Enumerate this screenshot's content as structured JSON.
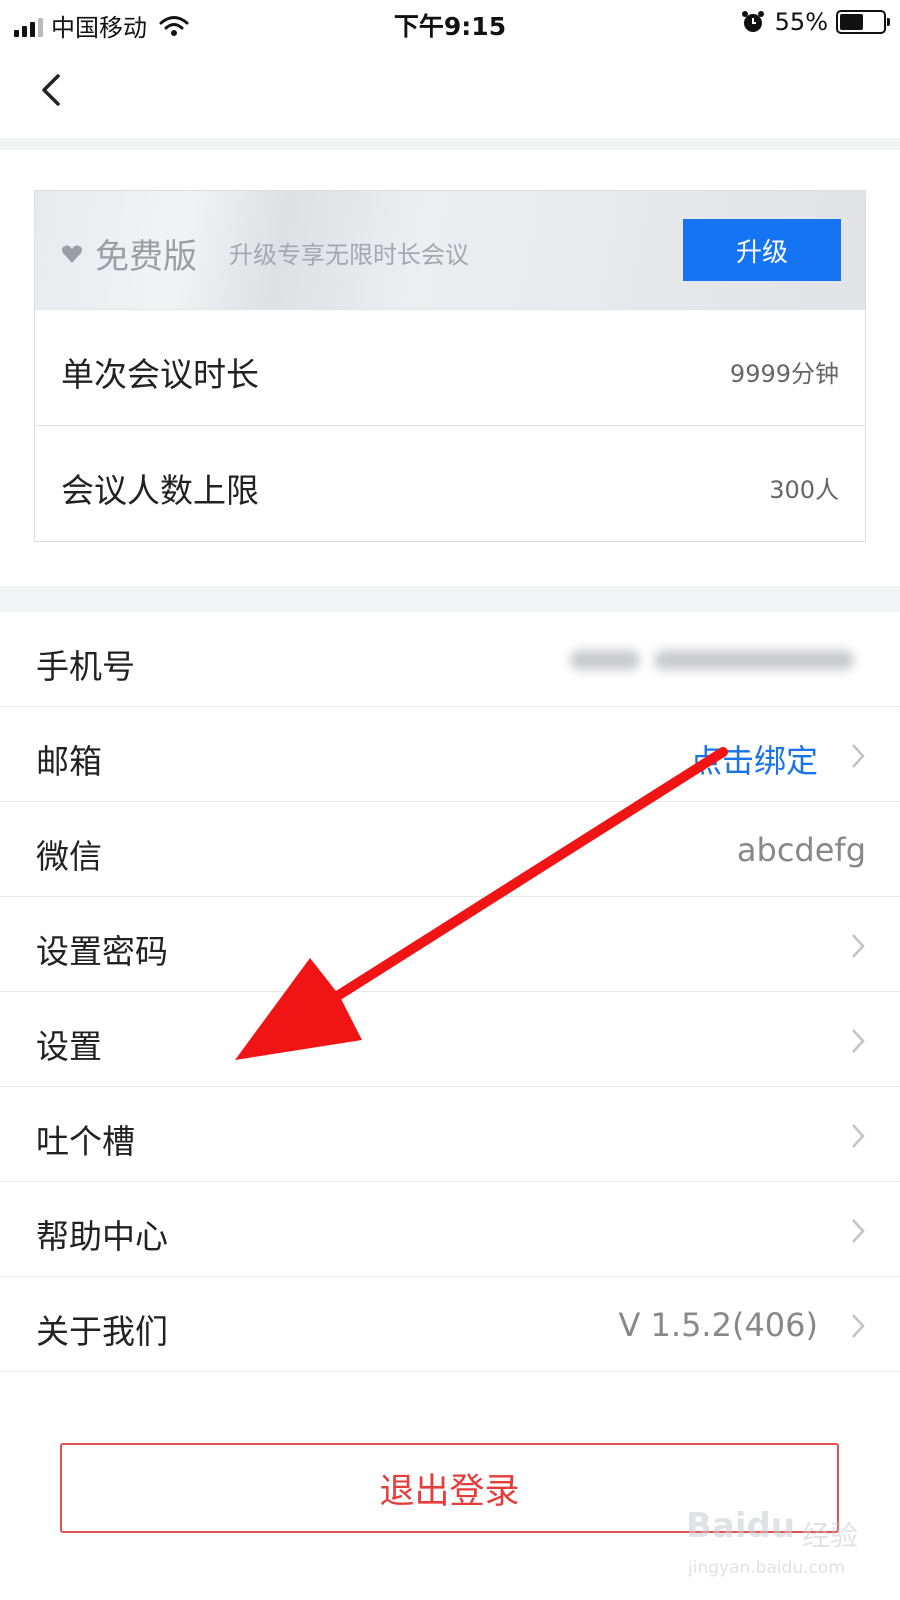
{
  "status_bar": {
    "carrier": "中国移动",
    "time": "下午9:15",
    "battery_percent": "55%",
    "battery_level": 0.55,
    "icons": [
      "signal-icon",
      "wifi-icon",
      "alarm-icon",
      "battery-icon"
    ]
  },
  "nav": {
    "back_icon": "chevron-left-icon"
  },
  "membership": {
    "plan_name": "免费版",
    "plan_desc": "升级专享无限时长会议",
    "upgrade_label": "升级",
    "accent_color": "#1574f3",
    "rows": [
      {
        "label": "单次会议时长",
        "value": "9999分钟"
      },
      {
        "label": "会议人数上限",
        "value": "300人"
      }
    ]
  },
  "account_list": {
    "items": [
      {
        "label": "手机号",
        "value": ""
      },
      {
        "label": "邮箱",
        "value": "点击绑定"
      },
      {
        "label": "微信",
        "value": "abcdefg"
      },
      {
        "label": "设置密码",
        "value": ""
      },
      {
        "label": "设置",
        "value": ""
      },
      {
        "label": "吐个槽",
        "value": ""
      },
      {
        "label": "帮助中心",
        "value": ""
      },
      {
        "label": "关于我们",
        "value": "V 1.5.2(406)"
      }
    ],
    "link_color": "#1a73e8"
  },
  "logout": {
    "label": "退出登录",
    "color": "#e53c3c"
  },
  "watermark": {
    "brand": "Baidu",
    "sub": "经验",
    "url": "jingyan.baidu.com"
  }
}
